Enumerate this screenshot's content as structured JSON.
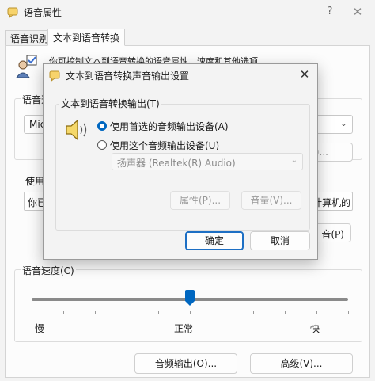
{
  "window": {
    "title": "语音属性",
    "help": "?",
    "close": "✕"
  },
  "tabs": [
    {
      "label": "语音识别"
    },
    {
      "label": "文本到语音转换"
    }
  ],
  "panel": {
    "description": "你可控制文本到语音转换的语音属性、速度和其他选项",
    "voice_group_label": "语音选",
    "voice_value": "Mic",
    "settings_label": "S)...",
    "usage_label": "使用",
    "usage_text": "你已",
    "usage_text_right": "计算机的",
    "preview_label": "音(P)",
    "speed_group_label": "语音速度(C)",
    "speed_slider_fraction": 0.5,
    "speed_slow": "慢",
    "speed_normal": "正常",
    "speed_fast": "快",
    "audio_output_button": "音频输出(O)...",
    "advanced_button": "高级(V)..."
  },
  "dialog": {
    "title": "文本到语音转换声音输出设置",
    "close": "✕",
    "group_label": "文本到语音转换输出(T)",
    "option_preferred": "使用首选的音频输出设备(A)",
    "option_this": "使用这个音频输出设备(U)",
    "device_value": "扬声器 (Realtek(R) Audio)",
    "properties_button": "属性(P)...",
    "volume_button": "音量(V)...",
    "ok_button": "确定",
    "cancel_button": "取消"
  }
}
